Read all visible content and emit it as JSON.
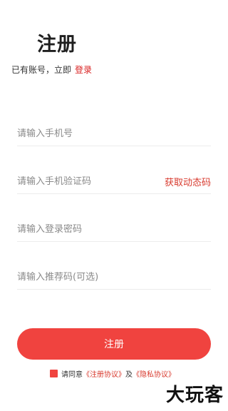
{
  "header": {
    "title": "注册",
    "login_prompt": "已有账号，立即",
    "login_link": "登录"
  },
  "form": {
    "phone_placeholder": "请输入手机号",
    "code_placeholder": "请输入手机验证码",
    "get_code_label": "获取动态码",
    "password_placeholder": "请输入登录密码",
    "referral_placeholder": "请输入推荐码(可选)"
  },
  "submit": {
    "label": "注册"
  },
  "agreement": {
    "prefix": "请同意",
    "terms_link": "《注册协议》",
    "conjunction": "及",
    "privacy_link": "《隐私协议》",
    "checked": true
  },
  "watermark": {
    "text": "大玩客"
  },
  "colors": {
    "accent": "#f0433f",
    "link": "#d83a2e"
  }
}
